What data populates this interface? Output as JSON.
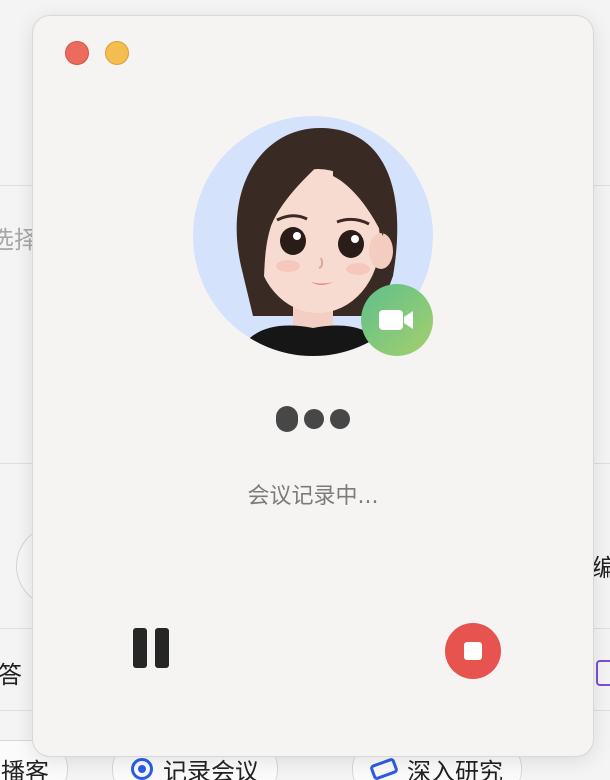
{
  "background_app": {
    "partial_labels": {
      "select_fragment": "选择",
      "answer_fragment": "答",
      "edit_fragment": "编",
      "podcast_fragment": "播客",
      "record_meeting": "记录会议",
      "deep_research": "深入研究"
    }
  },
  "recorder": {
    "window_controls": [
      "close",
      "minimize"
    ],
    "avatar_icon": "cartoon-girl-avatar",
    "badge_icon": "video-camera-icon",
    "status_text": "会议记录中...",
    "controls": {
      "pause_icon": "pause-icon",
      "stop_icon": "stop-icon"
    }
  },
  "colors": {
    "close": "#ec6b5f",
    "minimize": "#f4bd4f",
    "avatar_bg": "#d4e3fb",
    "badge_green": "#6cc285",
    "stop_red": "#e7534f"
  }
}
